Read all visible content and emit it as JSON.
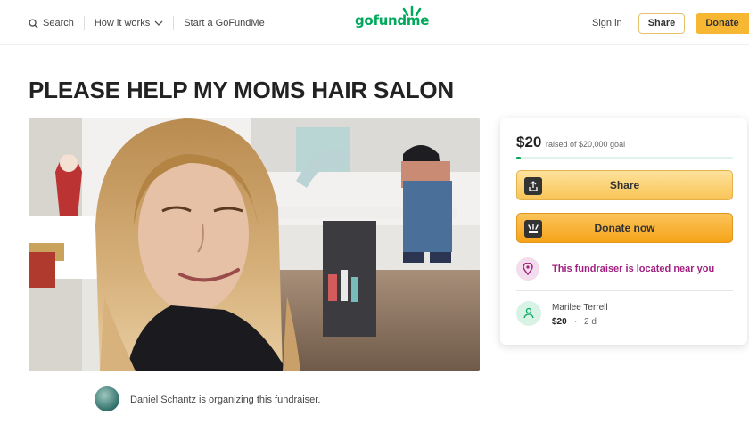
{
  "nav": {
    "search_label": "Search",
    "how_it_works_label": "How it works",
    "start_label": "Start a GoFundMe",
    "logo_text": "gofundme",
    "signin_label": "Sign in",
    "share_label": "Share",
    "donate_label": "Donate"
  },
  "campaign": {
    "title": "PLEASE HELP MY MOMS HAIR SALON",
    "raised": "$20",
    "goal_text": "raised of $20,000 goal",
    "progress_fraction": 0.001,
    "share_button_label": "Share",
    "donate_button_label": "Donate now",
    "location_note": "This fundraiser is located near you",
    "organizer_text": "Daniel Schantz is organizing this fundraiser."
  },
  "recent_donation": {
    "name": "Marilee Terrell",
    "amount": "$20",
    "separator": "·",
    "time": "2 d"
  },
  "colors": {
    "brand_green": "#02a95c",
    "donate_orange": "#f7b733",
    "location_magenta": "#a02080"
  },
  "icons": {
    "search": "search-icon",
    "chevron": "chevron-down-icon",
    "share": "share-icon",
    "donate": "donate-icon",
    "location": "location-pin-icon",
    "donor": "donor-icon"
  }
}
